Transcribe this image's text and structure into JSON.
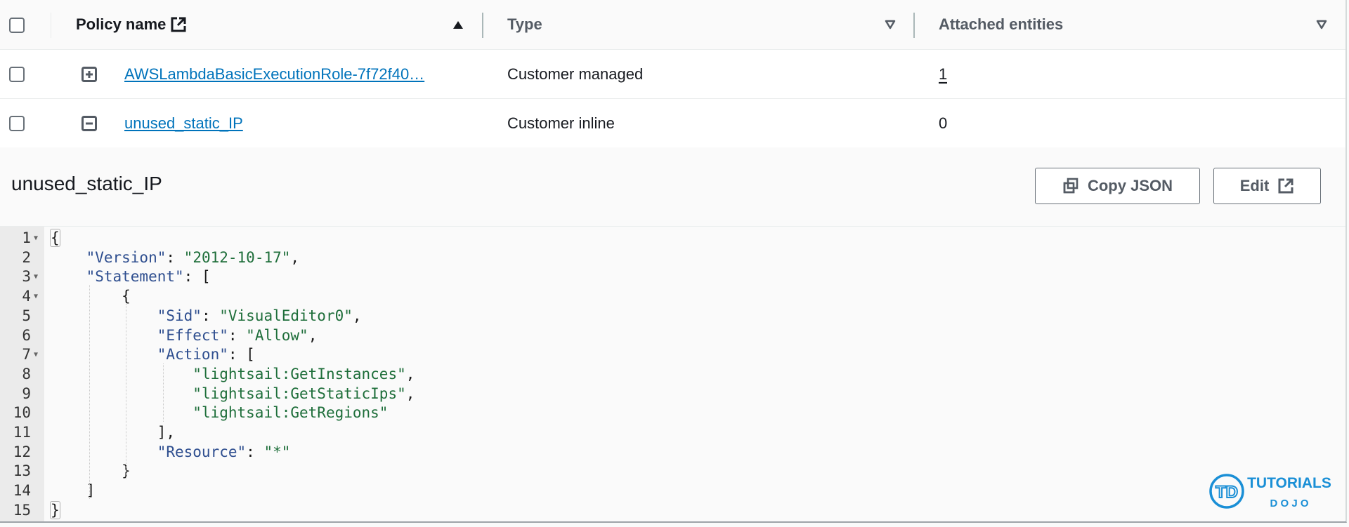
{
  "table": {
    "columns": [
      {
        "label": "Policy name",
        "sort": "ascending",
        "has_external_icon": true
      },
      {
        "label": "Type",
        "sort": "sortable"
      },
      {
        "label": "Attached entities",
        "sort": "sortable"
      }
    ],
    "rows": [
      {
        "name": "AWSLambdaBasicExecutionRole-7f72f40…",
        "expanded": false,
        "type": "Customer managed",
        "attached": "1",
        "selected": false
      },
      {
        "name": "unused_static_IP",
        "expanded": true,
        "type": "Customer inline",
        "attached": "0",
        "selected": false
      }
    ]
  },
  "detail": {
    "title": "unused_static_IP",
    "copy_json_label": "Copy JSON",
    "edit_label": "Edit"
  },
  "editor": {
    "lines": [
      {
        "n": "1",
        "fold": true
      },
      {
        "n": "2"
      },
      {
        "n": "3",
        "fold": true
      },
      {
        "n": "4",
        "fold": true
      },
      {
        "n": "5"
      },
      {
        "n": "6"
      },
      {
        "n": "7",
        "fold": true
      },
      {
        "n": "8"
      },
      {
        "n": "9"
      },
      {
        "n": "10"
      },
      {
        "n": "11"
      },
      {
        "n": "12"
      },
      {
        "n": "13"
      },
      {
        "n": "14"
      },
      {
        "n": "15"
      }
    ],
    "tokens": {
      "version_key": "\"Version\"",
      "version_val": "\"2012-10-17\"",
      "statement_key": "\"Statement\"",
      "sid_key": "\"Sid\"",
      "sid_val": "\"VisualEditor0\"",
      "effect_key": "\"Effect\"",
      "effect_val": "\"Allow\"",
      "action_key": "\"Action\"",
      "action_1": "\"lightsail:GetInstances\"",
      "action_2": "\"lightsail:GetStaticIps\"",
      "action_3": "\"lightsail:GetRegions\"",
      "resource_key": "\"Resource\"",
      "resource_val": "\"*\""
    }
  },
  "watermark": {
    "logo_initials": "TD",
    "line1": "TUTORIALS",
    "line2": "D O J O",
    "color": "#1a8fd6"
  },
  "colors": {
    "link": "#0073bb",
    "json_key": "#2e4e8f",
    "json_string": "#1e6e3a"
  }
}
